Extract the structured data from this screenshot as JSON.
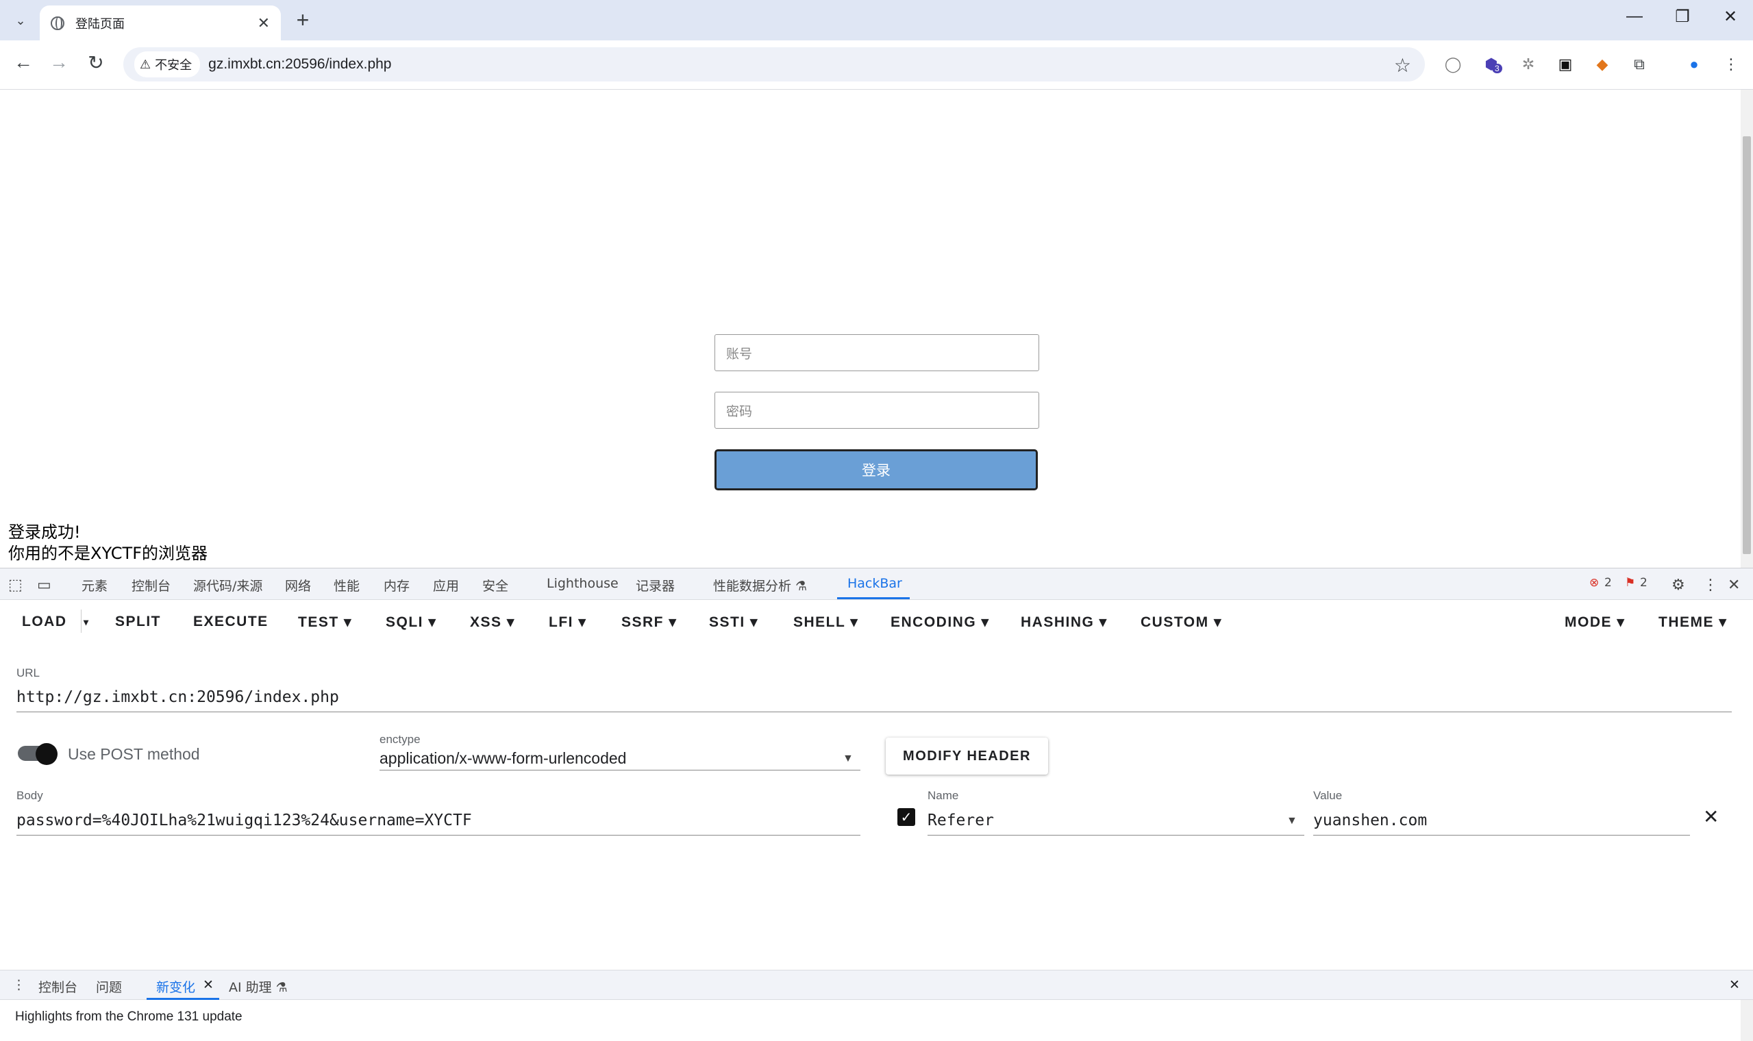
{
  "browser": {
    "tab_title": "登陆页面",
    "address": "gz.imxbt.cn:20596/index.php",
    "security_label": "不安全",
    "extension_badge": "3"
  },
  "page": {
    "username_placeholder": "账号",
    "password_placeholder": "密码",
    "login_button": "登录",
    "result_line1": "登录成功!",
    "result_line2": "你用的不是XYCTF的浏览器"
  },
  "devtools": {
    "tabs": [
      "元素",
      "控制台",
      "源代码/来源",
      "网络",
      "性能",
      "内存",
      "应用",
      "安全",
      "Lighthouse",
      "记录器",
      "性能数据分析 ⚗",
      "HackBar"
    ],
    "error_count": "2",
    "warning_count": "2"
  },
  "hackbar": {
    "menu": [
      "LOAD",
      "SPLIT",
      "EXECUTE",
      "TEST ▾",
      "SQLI ▾",
      "XSS ▾",
      "LFI ▾",
      "SSRF ▾",
      "SSTI ▾",
      "SHELL ▾",
      "ENCODING ▾",
      "HASHING ▾",
      "CUSTOM ▾"
    ],
    "mode": "MODE ▾",
    "theme": "THEME ▾",
    "url_label": "URL",
    "url_value": "http://gz.imxbt.cn:20596/index.php",
    "use_post_label": "Use POST method",
    "use_post_enabled": true,
    "enctype_label": "enctype",
    "enctype_value": "application/x-www-form-urlencoded",
    "modify_header_label": "MODIFY HEADER",
    "body_label": "Body",
    "body_value": "password=%40JOILha%21wuigqi123%24&username=XYCTF",
    "header_name_label": "Name",
    "header_name_value": "Referer",
    "header_value_label": "Value",
    "header_value_value": "yuanshen.com",
    "header_enabled": true
  },
  "drawer": {
    "tabs": [
      "控制台",
      "问题",
      "新变化",
      "AI 助理 ⚗"
    ],
    "highlights_text": "Highlights from the Chrome 131 update"
  },
  "colors": {
    "tabstrip_bg": "#dfe6f4",
    "login_button_bg": "#6a9fd6",
    "devtools_accent": "#1a73e8"
  }
}
